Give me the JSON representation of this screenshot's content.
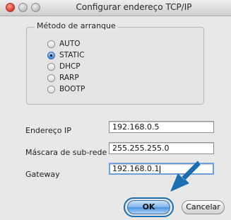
{
  "window": {
    "title": "Configurar endereço TCP/IP"
  },
  "boot_method": {
    "legend": "Método de arranque",
    "options": [
      {
        "label": "AUTO",
        "selected": false
      },
      {
        "label": "STATIC",
        "selected": true
      },
      {
        "label": "DHCP",
        "selected": false
      },
      {
        "label": "RARP",
        "selected": false
      },
      {
        "label": "BOOTP",
        "selected": false
      }
    ]
  },
  "fields": {
    "ip_label": "Endereço IP",
    "ip_value": "192.168.0.5",
    "mask_label": "Máscara de sub-rede",
    "mask_value": "255.255.255.0",
    "gateway_label": "Gateway",
    "gateway_value": "192.168.0.1"
  },
  "buttons": {
    "ok": "OK",
    "cancel": "Cancelar"
  },
  "colors": {
    "highlight_arrow": "#1a6fb2",
    "ok_button": "#4f95e2"
  }
}
